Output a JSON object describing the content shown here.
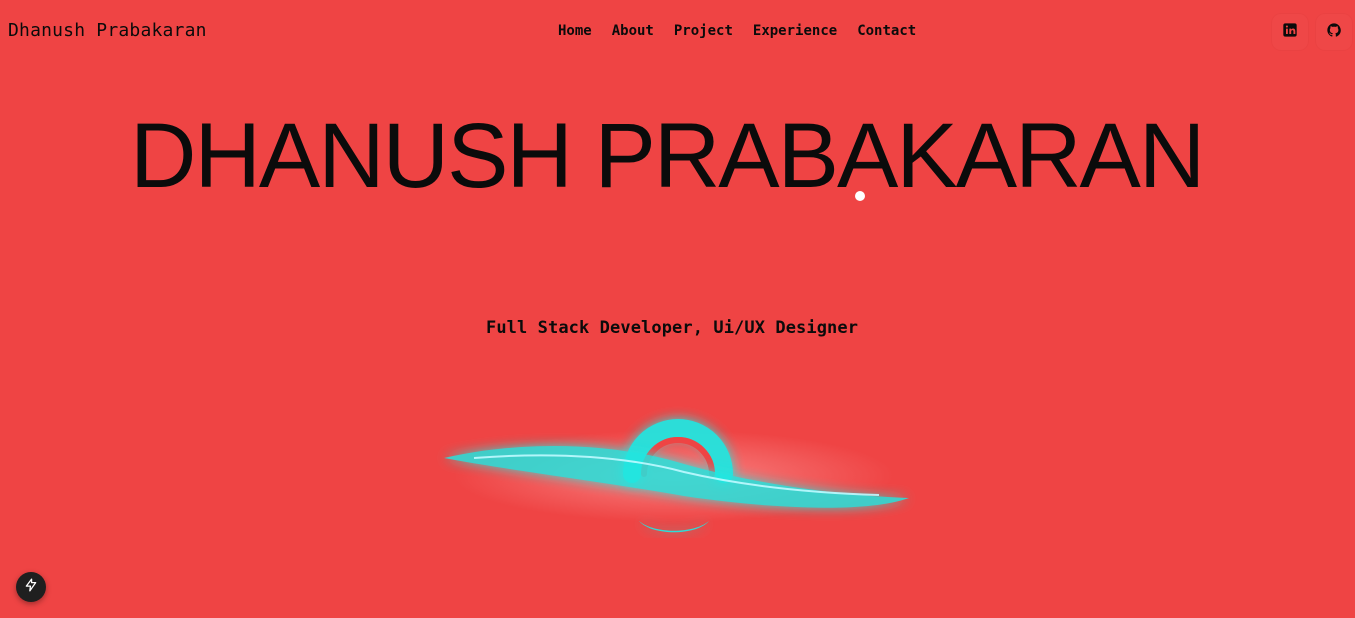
{
  "header": {
    "brand": "Dhanush Prabakaran",
    "nav": [
      "Home",
      "About",
      "Project",
      "Experience",
      "Contact"
    ],
    "social": [
      {
        "name": "linkedin-icon"
      },
      {
        "name": "github-icon"
      }
    ]
  },
  "hero": {
    "title": "DHANUSH PRABAKARAN",
    "subtitle": "Full Stack Developer, Ui/UX Designer"
  },
  "theme": {
    "background": "#ef4444",
    "text": "#0b0b0b",
    "accent": "#22e6e0"
  },
  "floating_button": {
    "icon": "lightning-icon"
  }
}
